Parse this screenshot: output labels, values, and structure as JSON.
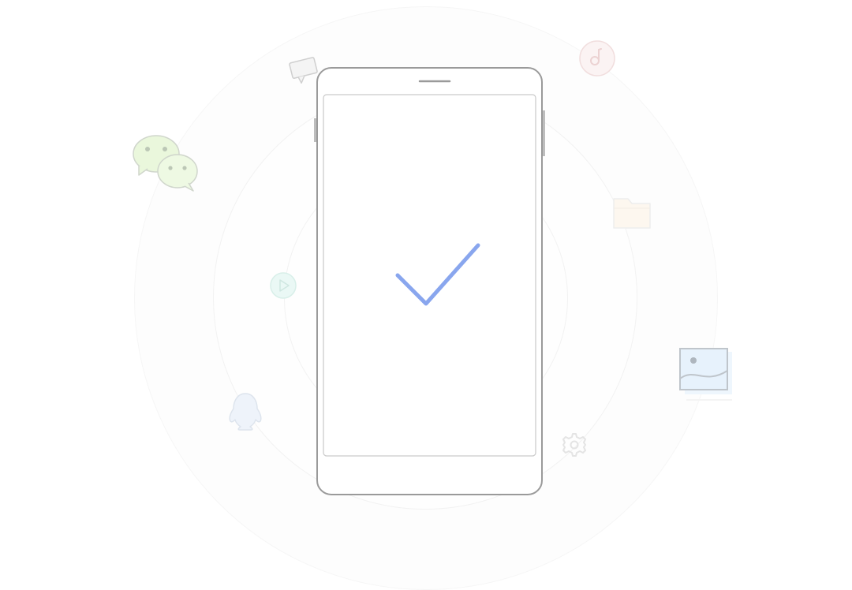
{
  "screen": {
    "status": "success",
    "background_color": "#ffffff",
    "accent_color": "#89a6ee"
  },
  "phone": {
    "frame_color": "#9a9a9a",
    "screen_state": "checkmark"
  },
  "floating_icons": [
    {
      "name": "chat-bubble-icon",
      "color": "#d8d8d8"
    },
    {
      "name": "music-note-icon",
      "color": "#f0d6d6"
    },
    {
      "name": "wechat-icon",
      "color": "#eaf7dc"
    },
    {
      "name": "folder-icon",
      "color": "#fdf6ee"
    },
    {
      "name": "play-icon",
      "color": "#dff5f1"
    },
    {
      "name": "image-icon",
      "color": "#e8f3fc"
    },
    {
      "name": "qq-penguin-icon",
      "color": "#eef2f7"
    },
    {
      "name": "gear-icon",
      "color": "#e6e6e6"
    }
  ]
}
